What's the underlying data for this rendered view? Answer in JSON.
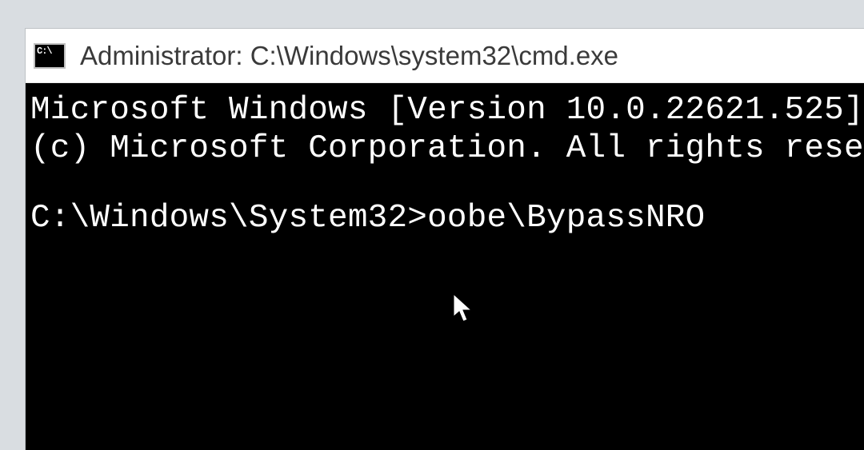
{
  "window": {
    "title": "Administrator: C:\\Windows\\system32\\cmd.exe"
  },
  "terminal": {
    "banner_line1": "Microsoft Windows [Version 10.0.22621.525]",
    "banner_line2": "(c) Microsoft Corporation. All rights reserved.",
    "prompt": "C:\\Windows\\System32>",
    "command": "oobe\\BypassNRO"
  }
}
